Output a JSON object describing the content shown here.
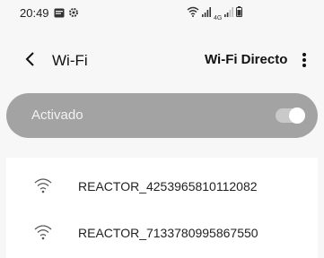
{
  "status_bar": {
    "time": "20:49",
    "icons_left": [
      "message-icon",
      "gear-icon"
    ],
    "icons_right": [
      "wifi-signal-icon",
      "cell-signal-icon",
      "lte-icon",
      "cell-signal-icon",
      "battery-icon"
    ],
    "network_type": "4G"
  },
  "header": {
    "title": "Wi-Fi",
    "wifi_direct_label": "Wi-Fi Directo",
    "back_icon": "chevron-left-icon",
    "more_icon": "more-vert-icon"
  },
  "master_switch": {
    "label": "Activado",
    "on": true
  },
  "networks": [
    {
      "name": "REACTOR_4253965810112082",
      "icon": "wifi-icon"
    },
    {
      "name": "REACTOR_7133780995867550",
      "icon": "wifi-icon"
    }
  ],
  "colors": {
    "background": "#f7f7f7",
    "toggle_bar": "#a3a3a3",
    "list_background": "#ffffff"
  }
}
